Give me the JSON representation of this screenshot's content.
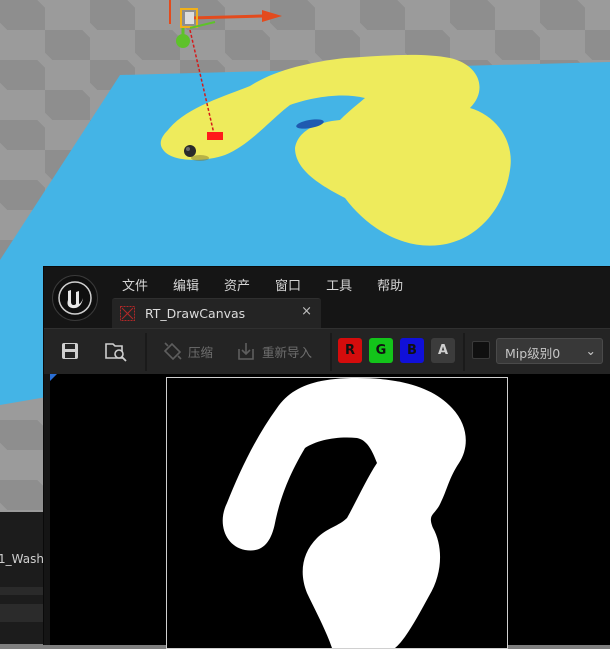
{
  "editor": {
    "menu": [
      "文件",
      "编辑",
      "资产",
      "窗口",
      "工具",
      "帮助"
    ],
    "tab": {
      "title": "RT_DrawCanvas",
      "close": "×"
    },
    "toolbar": {
      "compress_label": "压缩",
      "reimport_label": "重新导入",
      "channels": [
        {
          "label": "R",
          "bg": "#d40c0c",
          "fg": "#111111"
        },
        {
          "label": "G",
          "bg": "#13c41a",
          "fg": "#111111"
        },
        {
          "label": "B",
          "bg": "#1010d8",
          "fg": "#111111"
        },
        {
          "label": "A",
          "bg": "#3c3c3c",
          "fg": "#d0d0d0"
        }
      ],
      "mip_label": "Mip级别0",
      "mip_arrow": "⌄"
    }
  },
  "left_panel": {
    "tab_text": "1_Wash"
  },
  "colors": {
    "floor": "#44b4e6",
    "paint": "#eeeb5c",
    "gizmo_red": "#e34b1d",
    "gizmo_green": "#5ec22a",
    "marker_red": "#ff1a1a"
  }
}
